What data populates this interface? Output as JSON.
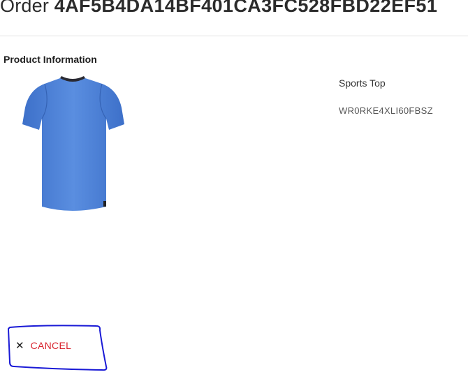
{
  "header": {
    "prefix": "Order",
    "order_id": "4AF5B4DA14BF401CA3FC528FBD22EF51"
  },
  "product_section": {
    "title": "Product Information",
    "product": {
      "name": "Sports Top",
      "sku": "WR0RKE4XLI60FBSZ",
      "image_icon": "blue-tshirt-image",
      "image_color": "#4a7fd4"
    }
  },
  "actions": {
    "cancel_icon": "close-icon",
    "cancel_label": "CANCEL",
    "cancel_color": "#d9242f"
  },
  "annotation_color": "#1a1ad6"
}
